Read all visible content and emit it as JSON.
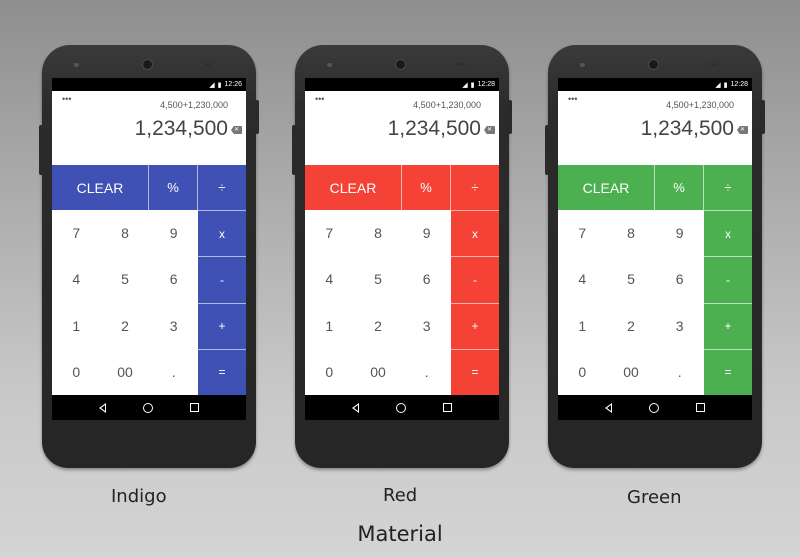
{
  "caption": "Material",
  "phones": [
    {
      "theme_name": "Indigo",
      "accent": "#3f51b5",
      "status_time": "12:26",
      "expression": "4,500+1,230,000",
      "result": "1,234,500"
    },
    {
      "theme_name": "Red",
      "accent": "#f44336",
      "status_time": "12:28",
      "expression": "4,500+1,230,000",
      "result": "1,234,500"
    },
    {
      "theme_name": "Green",
      "accent": "#4caf50",
      "status_time": "12:28",
      "expression": "4,500+1,230,000",
      "result": "1,234,500"
    }
  ],
  "keys": {
    "clear": "CLEAR",
    "percent": "%",
    "divide": "÷",
    "multiply": "x",
    "minus": "-",
    "plus": "+",
    "equals": "=",
    "digits": [
      "7",
      "8",
      "9",
      "4",
      "5",
      "6",
      "1",
      "2",
      "3",
      "0",
      "00",
      "."
    ]
  },
  "icons": {
    "overflow": "•••",
    "signal": "◢",
    "battery": "▮",
    "backspace": "✕"
  }
}
